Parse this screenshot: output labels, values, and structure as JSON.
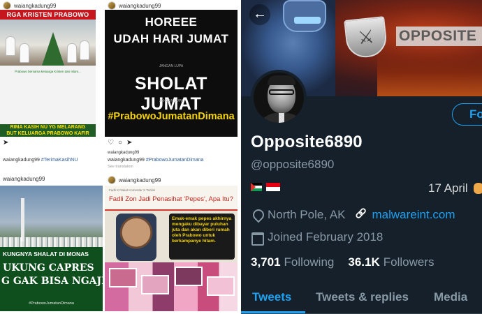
{
  "instagram": {
    "username": "waiangkadung99",
    "posts": [
      {
        "header": "RGA KRISTEN PRABOWO",
        "body": "Prabowo bersama keluarga Kristen dan Islam...",
        "footer_l1": "RIMA KASIH NU YG MELARANG",
        "footer_l2": "BUT KELUARGA PRABOWO KAFIR",
        "caption_user": "waiangkadung99",
        "caption_tag": "#TerimaKasihNU"
      },
      {
        "l1": "HOREEE",
        "l2": "UDAH HARI JUMAT",
        "l3": "JANGAN LUPA",
        "l4": "SHOLAT JUMAT",
        "l5": "JANGAN LUPA",
        "l6": "#PrabowoJumatanDimana",
        "caption_user": "waiangkadung99",
        "caption_tag": "#PrabowoJumatanDimana",
        "translation": "See translation"
      },
      {
        "t1": "KUNGNYA SHALAT DI MONAS",
        "t2": "UKUNG CAPRES",
        "t3": "G GAK BISA NGAJI",
        "t4": "#PrabowoJumatanDimana"
      },
      {
        "kicker": "Fadli X Rakat Komentar X Terkini",
        "title": "Fadli Zon Jadi Penasihat 'Pepes', Apa Itu?",
        "bubble": "Emak-emak pepes akhirnya mengaku dibayar puluhan juta dan akan diberi rumah oleh Prabowo untuk berkampanye hitam."
      }
    ]
  },
  "twitter": {
    "back_icon": "←",
    "banner_logo_text": "OPPOSITE",
    "follow_label": "Fo",
    "display_name": "Opposite6890",
    "handle": "@opposite6890",
    "birthday": "17 April",
    "location": "North Pole, AK",
    "website": "malwareint.com",
    "joined": "Joined February 2018",
    "following_count": "3,701",
    "following_label": "Following",
    "followers_count": "36.1K",
    "followers_label": "Followers",
    "tabs": [
      "Tweets",
      "Tweets & replies",
      "Media"
    ],
    "colors": {
      "background": "#15202b",
      "accent": "#1da1f2",
      "muted": "#8899a6"
    }
  }
}
